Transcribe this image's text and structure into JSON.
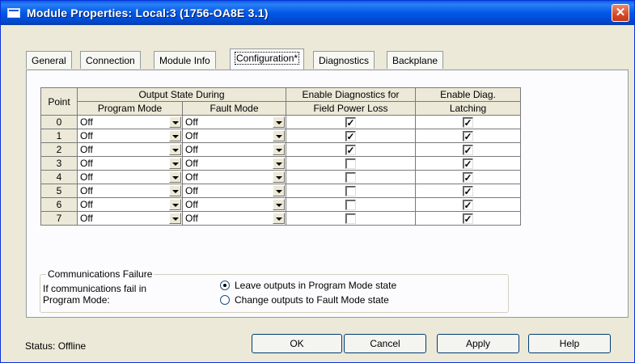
{
  "window": {
    "title": "Module Properties: Local:3 (1756-OA8E 3.1)"
  },
  "tabs": [
    {
      "label": "General"
    },
    {
      "label": "Connection"
    },
    {
      "label": "Module Info"
    },
    {
      "label": "Configuration*"
    },
    {
      "label": "Diagnostics"
    },
    {
      "label": "Backplane"
    }
  ],
  "active_tab": "Configuration*",
  "table": {
    "headers": {
      "point": "Point",
      "output_state_during": "Output State During",
      "program_mode": "Program Mode",
      "fault_mode": "Fault Mode",
      "enable_diag_line1": "Enable Diagnostics for",
      "enable_diag_line2": "Field Power Loss",
      "enable_latch_line1": "Enable Diag.",
      "enable_latch_line2": "Latching"
    },
    "rows": [
      {
        "point": "0",
        "program_mode": "Off",
        "fault_mode": "Off",
        "diag_field_power_loss": true,
        "diag_latching": true
      },
      {
        "point": "1",
        "program_mode": "Off",
        "fault_mode": "Off",
        "diag_field_power_loss": true,
        "diag_latching": true
      },
      {
        "point": "2",
        "program_mode": "Off",
        "fault_mode": "Off",
        "diag_field_power_loss": true,
        "diag_latching": true
      },
      {
        "point": "3",
        "program_mode": "Off",
        "fault_mode": "Off",
        "diag_field_power_loss": false,
        "diag_latching": true
      },
      {
        "point": "4",
        "program_mode": "Off",
        "fault_mode": "Off",
        "diag_field_power_loss": false,
        "diag_latching": true
      },
      {
        "point": "5",
        "program_mode": "Off",
        "fault_mode": "Off",
        "diag_field_power_loss": false,
        "diag_latching": true
      },
      {
        "point": "6",
        "program_mode": "Off",
        "fault_mode": "Off",
        "diag_field_power_loss": false,
        "diag_latching": true
      },
      {
        "point": "7",
        "program_mode": "Off",
        "fault_mode": "Off",
        "diag_field_power_loss": false,
        "diag_latching": true
      }
    ]
  },
  "comm_failure": {
    "group_label": "Communications Failure",
    "desc_line1": "If communications fail in",
    "desc_line2": "Program Mode:",
    "options": [
      {
        "label": "Leave outputs in Program Mode state",
        "selected": true
      },
      {
        "label": "Change outputs to Fault Mode state",
        "selected": false
      }
    ]
  },
  "status": {
    "label": "Status:",
    "value": "Offline"
  },
  "buttons": {
    "ok": "OK",
    "cancel": "Cancel",
    "apply": "Apply",
    "help": "Help"
  },
  "colors": {
    "titlebar": "#0058e6",
    "dialog_bg": "#ece9d8",
    "close_button": "#d84a24"
  }
}
